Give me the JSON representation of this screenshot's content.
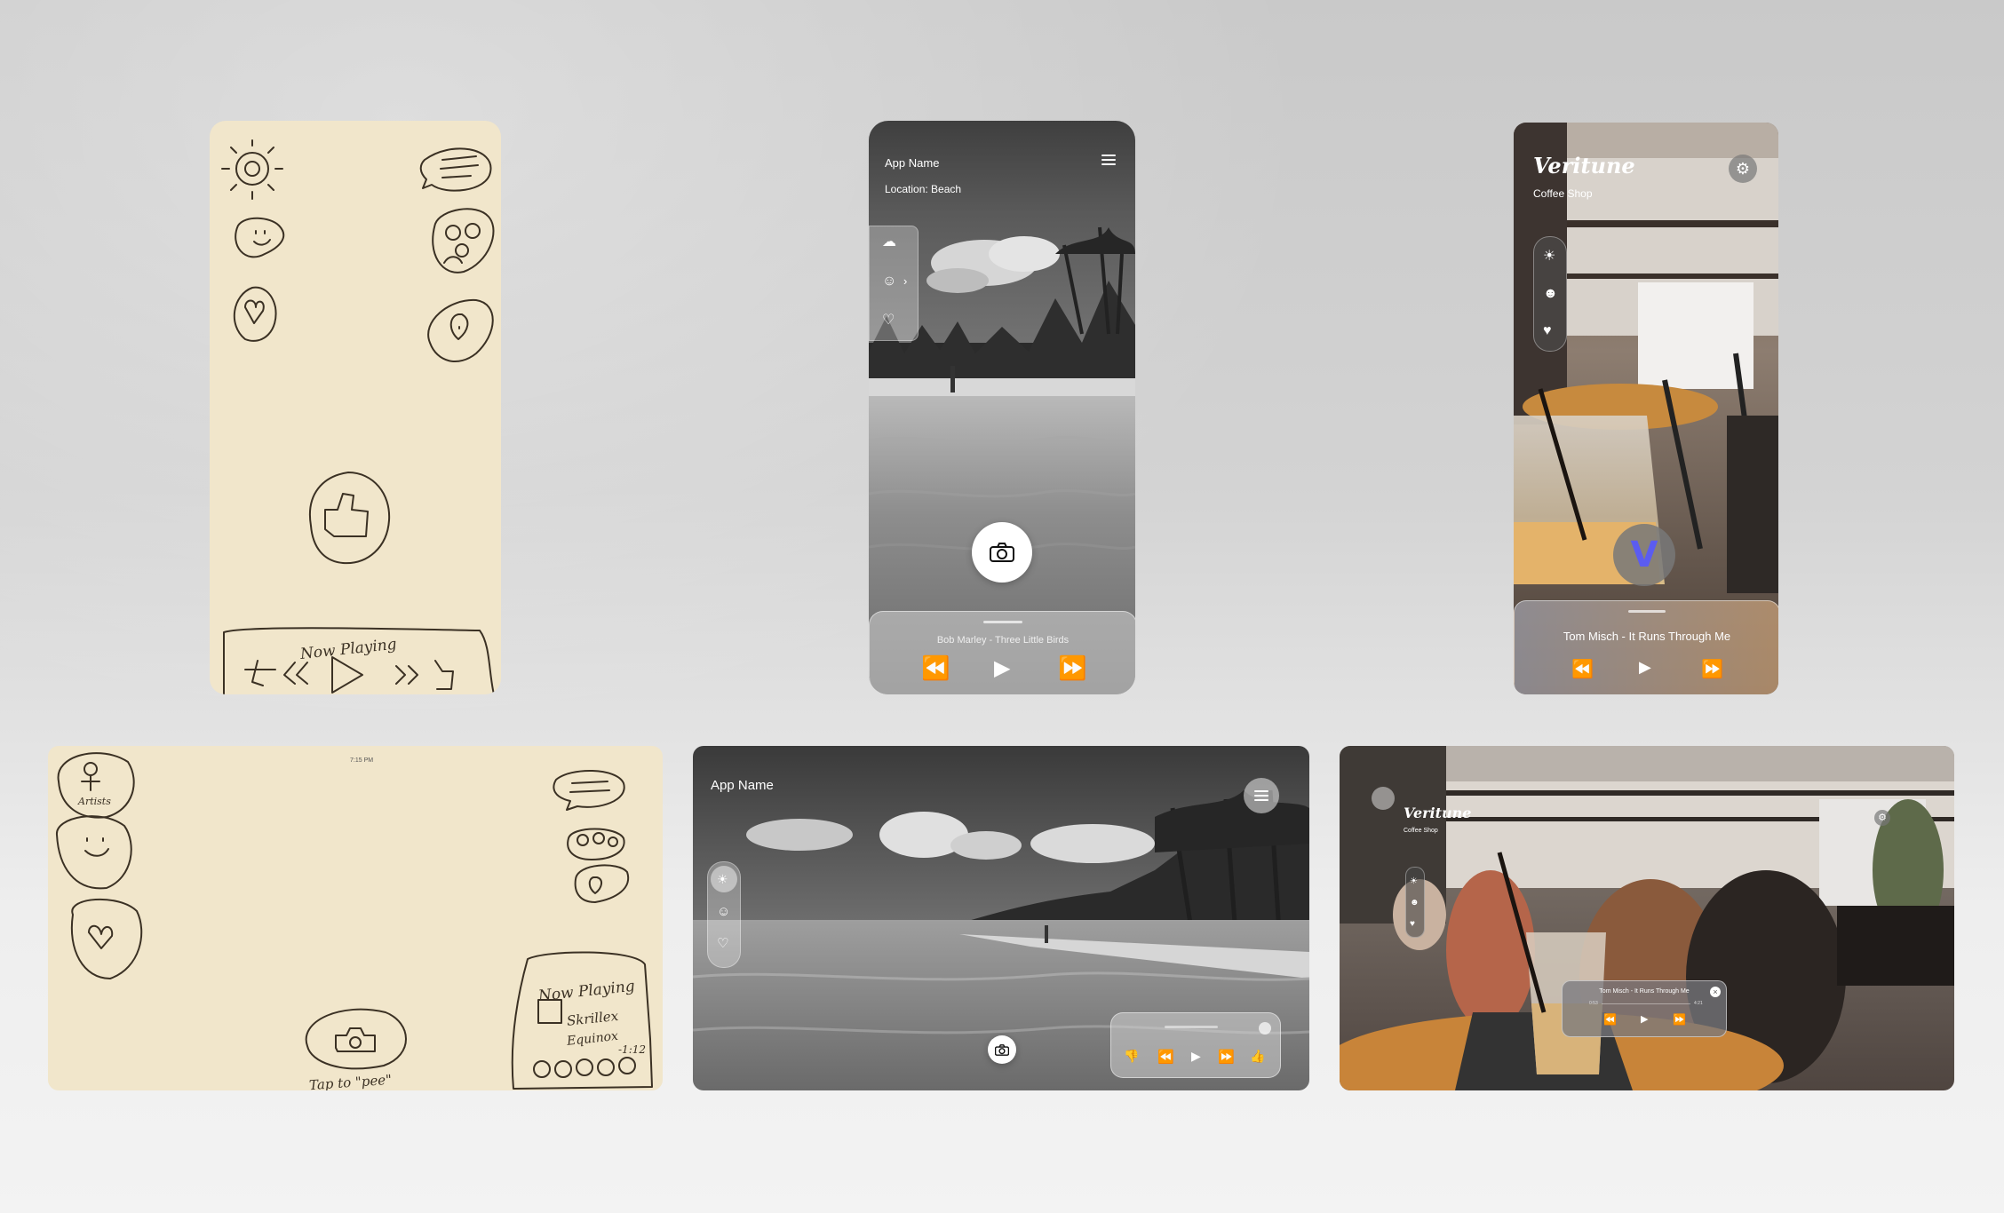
{
  "beach_phone": {
    "app_name": "App Name",
    "location": "Location: Beach",
    "track": "Bob Marley - Three Little Birds"
  },
  "cafe_phone": {
    "brand": "Veritune",
    "subtitle": "Coffee Shop",
    "track": "Tom Misch - It Runs Through Me"
  },
  "sketch_phone": {
    "now_playing": "Now Playing"
  },
  "sketch_tablet": {
    "time": "7:15 PM",
    "artists": "Artists",
    "now_playing": "Now Playing",
    "song": "Skrillex",
    "album": "Equinox",
    "time_left": "-1:12",
    "tap_hint": "Tap to \"pee\""
  },
  "beach_tablet": {
    "app_name": "App Name"
  },
  "cafe_tablet": {
    "brand": "Veritune",
    "subtitle": "Coffee Shop",
    "track": "Tom Misch - It Runs Through Me",
    "elapsed": "0:53",
    "remaining": "4:21"
  },
  "colors": {
    "sketch_paper": "#f1e6cb",
    "ink": "#3b3124",
    "veritune_accent": "#5b5cf0"
  }
}
